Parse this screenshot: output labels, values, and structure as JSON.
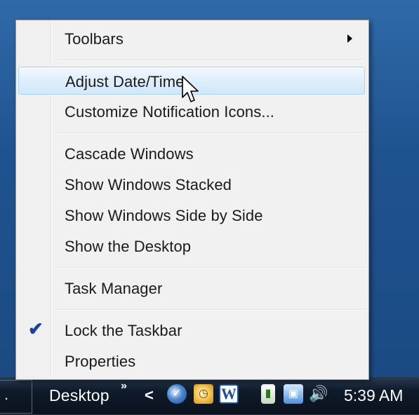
{
  "context_menu": {
    "items": [
      {
        "label": "Toolbars",
        "submenu": true
      },
      {
        "label": "Adjust Date/Time",
        "hovered": true
      },
      {
        "label": "Customize Notification Icons..."
      },
      {
        "label": "Cascade Windows"
      },
      {
        "label": "Show Windows Stacked"
      },
      {
        "label": "Show Windows Side by Side"
      },
      {
        "label": "Show the Desktop"
      },
      {
        "label": "Task Manager"
      },
      {
        "label": "Lock the Taskbar",
        "checked": true
      },
      {
        "label": "Properties"
      }
    ],
    "check_glyph": "✔"
  },
  "taskbar": {
    "left_box_text": ".",
    "toolbar_label": "Desktop",
    "more_glyph": "»",
    "tray_expand_glyph": "<",
    "tray_icons": [
      "check-app-icon",
      "clock-app-icon",
      "word-icon",
      "power-icon",
      "network-icon",
      "volume-icon"
    ],
    "word_icon_text": "W",
    "clock": "5:39 AM"
  },
  "colors": {
    "menu_background": "#f1f1f1",
    "hover_highlight": "#dfeefb",
    "check_color": "#1d3f9f",
    "desktop_blue": "#1f5390",
    "taskbar_dark": "#0f1b2b"
  }
}
